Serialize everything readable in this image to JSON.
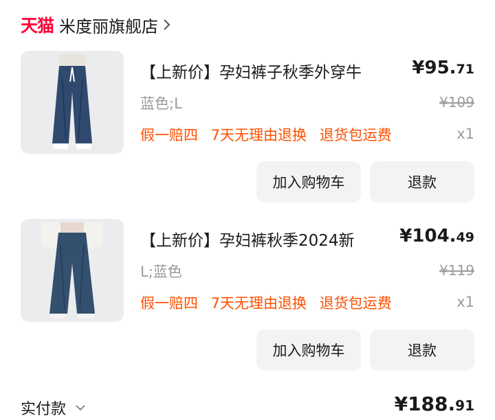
{
  "store": {
    "platform_logo": "天猫",
    "name": "米度丽旗舰店",
    "chevron_icon": "chevron-right-icon"
  },
  "items": [
    {
      "title": "【上新价】孕妇裤子秋季外穿牛",
      "price_currency": "¥",
      "price_int": "95.",
      "price_cents": "71",
      "sku": "蓝色;L",
      "original_price": "¥109",
      "services": [
        "假一赔四",
        "7天无理由退换",
        "退货包运费"
      ],
      "quantity": "x1",
      "add_to_cart_label": "加入购物车",
      "refund_label": "退款"
    },
    {
      "title": "【上新价】孕妇裤秋季2024新",
      "price_currency": "¥",
      "price_int": "104.",
      "price_cents": "49",
      "sku": "L;蓝色",
      "original_price": "¥119",
      "services": [
        "假一赔四",
        "7天无理由退换",
        "退货包运费"
      ],
      "quantity": "x1",
      "add_to_cart_label": "加入购物车",
      "refund_label": "退款"
    }
  ],
  "footer": {
    "paid_label": "实付款",
    "total_currency": "¥",
    "total_int": "188.",
    "total_cents": "91"
  },
  "colors": {
    "tmall_red": "#ff0036",
    "service_orange": "#ff5000",
    "muted_gray": "#9a9aa0",
    "button_bg": "#f3f3f5"
  }
}
